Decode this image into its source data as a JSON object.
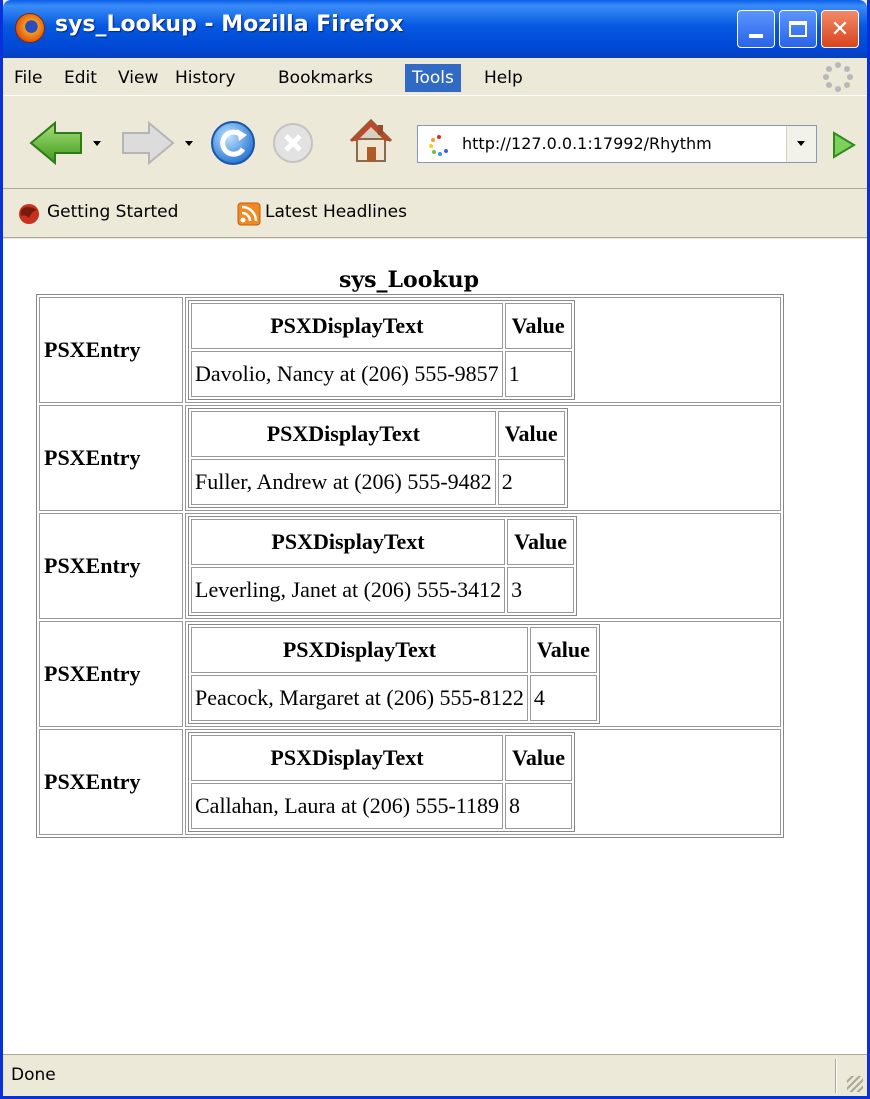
{
  "window": {
    "title": "sys_Lookup - Mozilla Firefox"
  },
  "menu": {
    "items": [
      {
        "label": "File"
      },
      {
        "label": "Edit"
      },
      {
        "label": "View"
      },
      {
        "label": "History"
      },
      {
        "label": "Bookmarks"
      },
      {
        "label": "Tools"
      },
      {
        "label": "Help"
      }
    ],
    "active": "Tools"
  },
  "navigation": {
    "url": "http://127.0.0.1:17992/Rhythm"
  },
  "bookmarks": [
    {
      "label": "Getting Started",
      "icon": "firefox-bookmark-icon"
    },
    {
      "label": "Latest Headlines",
      "icon": "rss-feed-icon"
    }
  ],
  "page": {
    "heading": "sys_Lookup",
    "entry_label": "PSXEntry",
    "columns": {
      "display": "PSXDisplayText",
      "value": "Value"
    },
    "entries": [
      {
        "text": "Davolio, Nancy at (206) 555-9857",
        "value": "1"
      },
      {
        "text": "Fuller, Andrew at (206) 555-9482",
        "value": "2"
      },
      {
        "text": "Leverling, Janet at (206) 555-3412",
        "value": "3"
      },
      {
        "text": "Peacock, Margaret at (206) 555-8122",
        "value": "4"
      },
      {
        "text": "Callahan, Laura at (206) 555-1189",
        "value": "8"
      }
    ]
  },
  "status": {
    "text": "Done"
  },
  "colors": {
    "titlebar": "#0558e0",
    "chrome": "#ece9d8",
    "menu_highlight": "#316ac5"
  }
}
